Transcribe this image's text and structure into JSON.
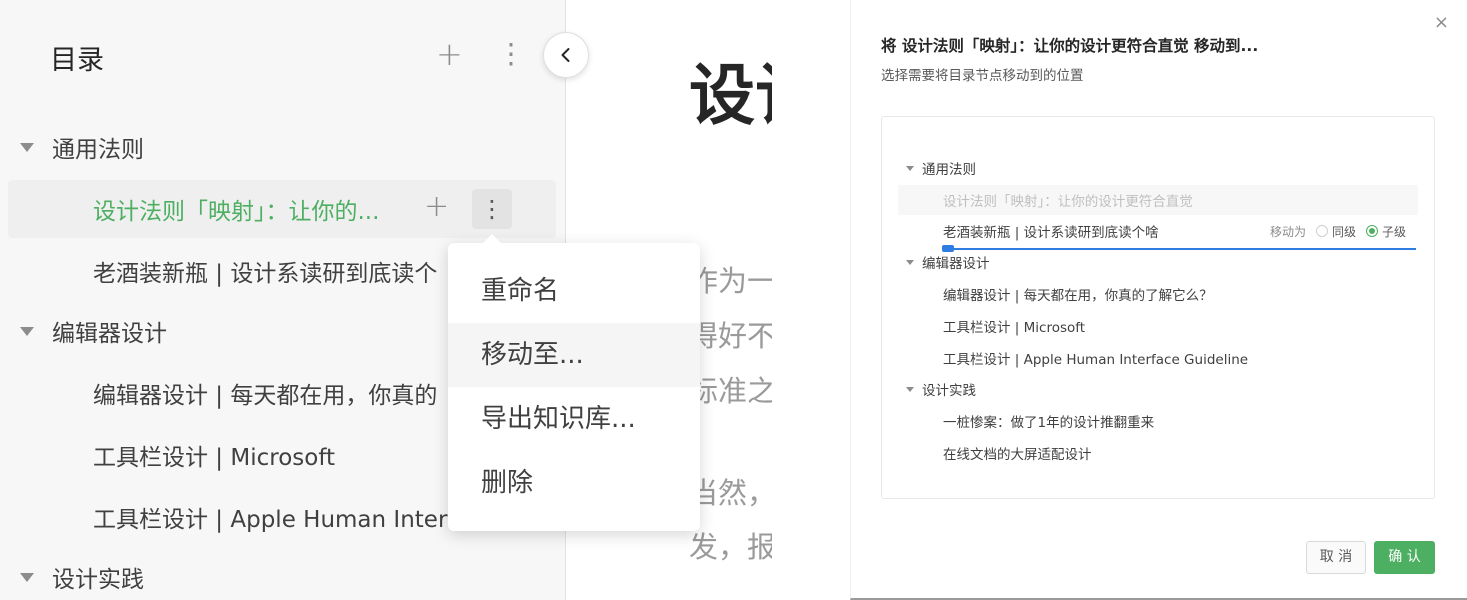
{
  "sidebar": {
    "title": "目录",
    "add_icon": "+",
    "more_icon": "⋮",
    "items": [
      {
        "type": "group",
        "label": "通用法则"
      },
      {
        "type": "leaf",
        "label": "设计法则「映射」：让你的...",
        "selected": true
      },
      {
        "type": "leaf",
        "label": "老酒装新瓶 | 设计系读研到底读个"
      },
      {
        "type": "group",
        "label": "编辑器设计"
      },
      {
        "type": "leaf",
        "label": "编辑器设计 | 每天都在用，你真的"
      },
      {
        "type": "leaf",
        "label": "工具栏设计 | Microsoft"
      },
      {
        "type": "leaf",
        "label": "工具栏设计 | Apple Human Interf"
      },
      {
        "type": "group",
        "label": "设计实践"
      }
    ]
  },
  "document": {
    "heading": "设计",
    "lines": [
      "作为一",
      "得好不",
      "标准之",
      "当然，",
      "发，报"
    ]
  },
  "context_menu": {
    "items": [
      "重命名",
      "移动至...",
      "导出知识库...",
      "删除"
    ]
  },
  "dialog": {
    "close_icon": "×",
    "title": "将 设计法则「映射」：让你的设计更符合直觉 移动到...",
    "subtitle": "选择需要将目录节点移动到的位置",
    "tree": [
      {
        "type": "group",
        "label": "通用法则"
      },
      {
        "type": "leaf",
        "label": "设计法则「映射」：让你的设计更符合直觉",
        "disabled": true
      },
      {
        "type": "leaf",
        "label": "老酒装新瓶 | 设计系读研到底读个啥"
      },
      {
        "type": "group",
        "label": "编辑器设计"
      },
      {
        "type": "leaf",
        "label": "编辑器设计 | 每天都在用，你真的了解它么？"
      },
      {
        "type": "leaf",
        "label": "工具栏设计 | Microsoft"
      },
      {
        "type": "leaf",
        "label": "工具栏设计 | Apple Human Interface Guideline"
      },
      {
        "type": "group",
        "label": "设计实践"
      },
      {
        "type": "leaf",
        "label": "一桩惨案：做了1年的设计推翻重来"
      },
      {
        "type": "leaf",
        "label": "在线文档的大屏适配设计"
      }
    ],
    "move_as_label": "移动为",
    "option_sibling": "同级",
    "option_child": "子级",
    "selected_option": "子级",
    "cancel_label": "取 消",
    "confirm_label": "确 认"
  },
  "colors": {
    "accent": "#4caf62",
    "drop_indicator": "#2f7de1"
  }
}
